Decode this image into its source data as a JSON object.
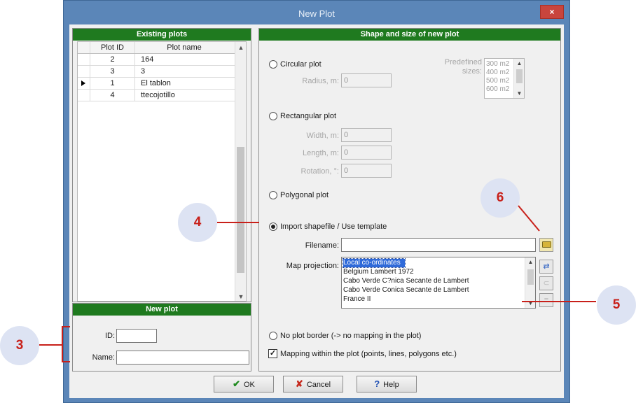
{
  "window": {
    "title": "New Plot",
    "close_glyph": "×"
  },
  "existing_plots": {
    "header": "Existing plots",
    "columns": [
      "Plot ID",
      "Plot name"
    ],
    "rows": [
      {
        "id": "2",
        "name": "164"
      },
      {
        "id": "3",
        "name": "3"
      },
      {
        "id": "1",
        "name": "El tablon",
        "current": true
      },
      {
        "id": "4",
        "name": "ttecojotillo"
      }
    ]
  },
  "new_plot": {
    "header": "New plot",
    "id_label": "ID:",
    "id_value": "",
    "name_label": "Name:",
    "name_value": ""
  },
  "shape": {
    "header": "Shape and size of new plot",
    "circular": {
      "label": "Circular plot",
      "radius_label": "Radius, m:",
      "radius_value": "0"
    },
    "predefined": {
      "label_line1": "Predefined",
      "label_line2": "sizes:",
      "items": [
        "300 m2",
        "400 m2",
        "500 m2",
        "600 m2"
      ]
    },
    "rectangular": {
      "label": "Rectangular plot",
      "width_label": "Width, m:",
      "width_value": "0",
      "length_label": "Length, m:",
      "length_value": "0",
      "rotation_label": "Rotation, °:",
      "rotation_value": "0"
    },
    "polygonal": {
      "label": "Polygonal plot"
    },
    "import": {
      "label": "Import shapefile / Use template",
      "filename_label": "Filename:",
      "filename_value": "",
      "projection_label": "Map projection:",
      "projections": [
        "Local co-ordinates",
        "Belgium Lambert 1972",
        "Cabo Verde C?nica Secante de Lambert",
        "Cabo Verde Conica Secante de Lambert",
        "France II"
      ],
      "selected_projection": "Local co-ordinates"
    },
    "no_border": {
      "label": "No plot border (-> no mapping in the plot)"
    },
    "mapping": {
      "label": "Mapping within the plot (points, lines, polygons etc.)",
      "checked": true
    }
  },
  "buttons": {
    "ok": "OK",
    "cancel": "Cancel",
    "help": "Help",
    "ok_icon": "✔",
    "cancel_icon": "✘",
    "help_icon": "?"
  },
  "callouts": {
    "c3": "3",
    "c4": "4",
    "c5": "5",
    "c6": "6"
  },
  "colors": {
    "title_bar": "#5b86b8",
    "panel_header": "#1f7a1f",
    "selection": "#2f6ad9",
    "callout_text": "#c8201a",
    "callout_bg": "#dde3f3"
  }
}
